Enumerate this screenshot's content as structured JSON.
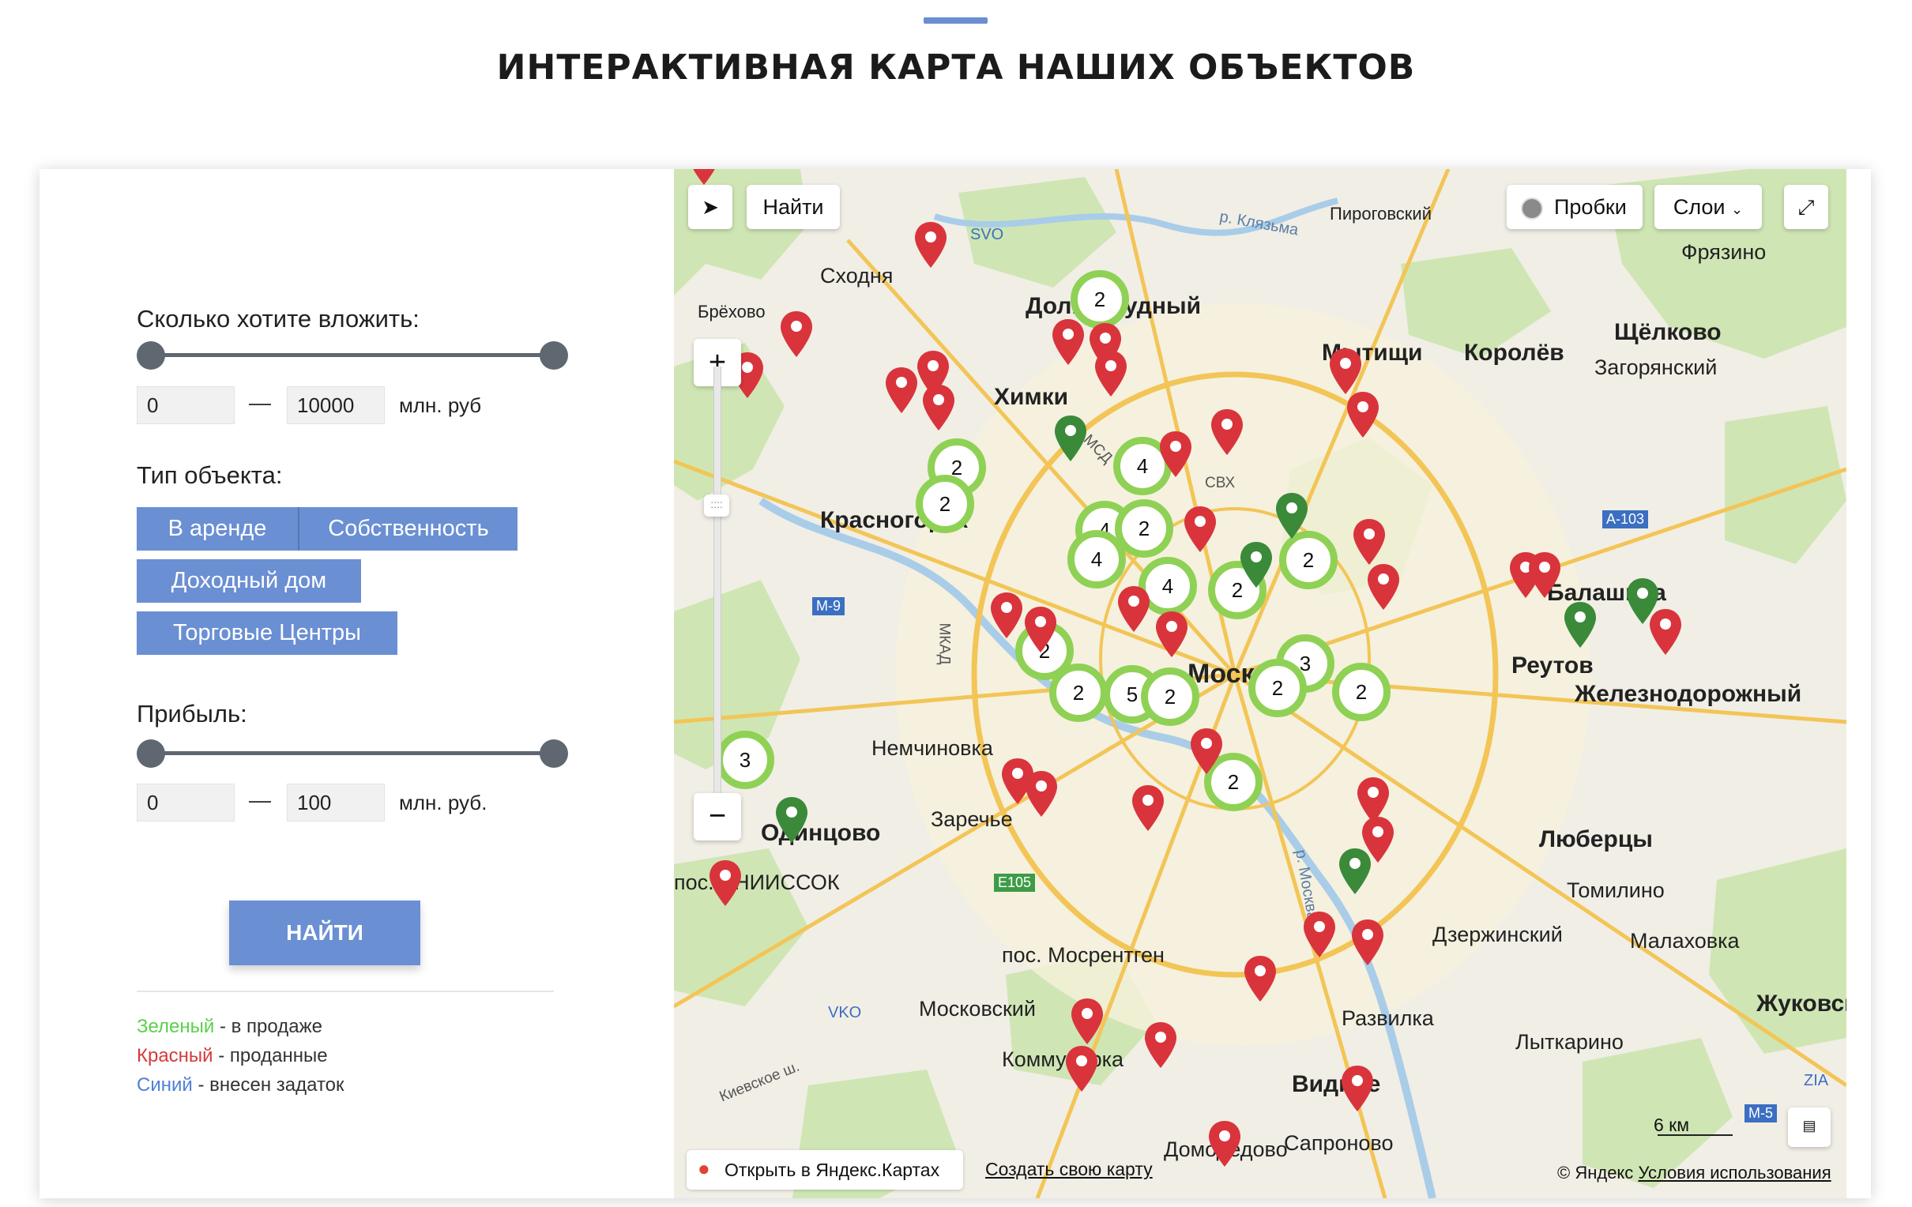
{
  "page": {
    "title": "ИНТЕРАКТИВНАЯ КАРТА НАШИХ ОБЪЕКТОВ"
  },
  "filters": {
    "invest_label": "Сколько хотите вложить:",
    "invest_min": "0",
    "invest_max": "10000",
    "invest_unit": "млн. руб",
    "type_label": "Тип объекта:",
    "types": [
      "В аренде",
      "Собственность",
      "Доходный дом",
      "Торговые Центры"
    ],
    "profit_label": "Прибыль:",
    "profit_min": "0",
    "profit_max": "100",
    "profit_unit": "млн. руб.",
    "dash": "—",
    "search_label": "НАЙТИ"
  },
  "legend": [
    {
      "word": "Зеленый",
      "rest": " - в продаже",
      "color": "#5bd04a"
    },
    {
      "word": "Красный",
      "rest": " - проданные",
      "color": "#d63a3a"
    },
    {
      "word": "Синий",
      "rest": " - внесен задаток",
      "color": "#4f7fd6"
    }
  ],
  "map": {
    "find_label": "Найти",
    "traffic_label": "Пробки",
    "layers_label": "Слои",
    "scale_label": "6 км",
    "open_label": "Открыть в Яндекс.Картах",
    "create_label": "Создать свою карту",
    "copyright": "© Яндекс",
    "terms": "Условия использования",
    "places": [
      "Сходня",
      "Брёхово",
      "Долгопрудный",
      "Химки",
      "Мытищи",
      "Королёв",
      "Щёлково",
      "Загорянский",
      "Фрязино",
      "Пироговский",
      "Красногорск",
      "Балашиха",
      "Реутов",
      "Железнодорожный",
      "Немчиновка",
      "Заречье",
      "Одинцово",
      "пос. ВНИИССОК",
      "Москва",
      "Люберцы",
      "Томилино",
      "Малаховка",
      "Дзержинский",
      "пос. Мосрентген",
      "Московский",
      "Коммунарка",
      "Развилка",
      "Видное",
      "Лыткарино",
      "Жуковский",
      "Сапроново",
      "Домодедово"
    ],
    "road_labels": [
      "М-9",
      "A-103",
      "E105",
      "М-5",
      "МКАД",
      "СВХ",
      "МСД",
      "SVO",
      "VKO",
      "ZIA",
      "р. Клязьма",
      "р. Москва",
      "Киевское ш."
    ],
    "clusters": [
      "2",
      "2",
      "2",
      "4",
      "4",
      "2",
      "4",
      "4",
      "2",
      "2",
      "2",
      "3",
      "2",
      "2",
      "5",
      "2",
      "2",
      "3",
      "2"
    ]
  }
}
